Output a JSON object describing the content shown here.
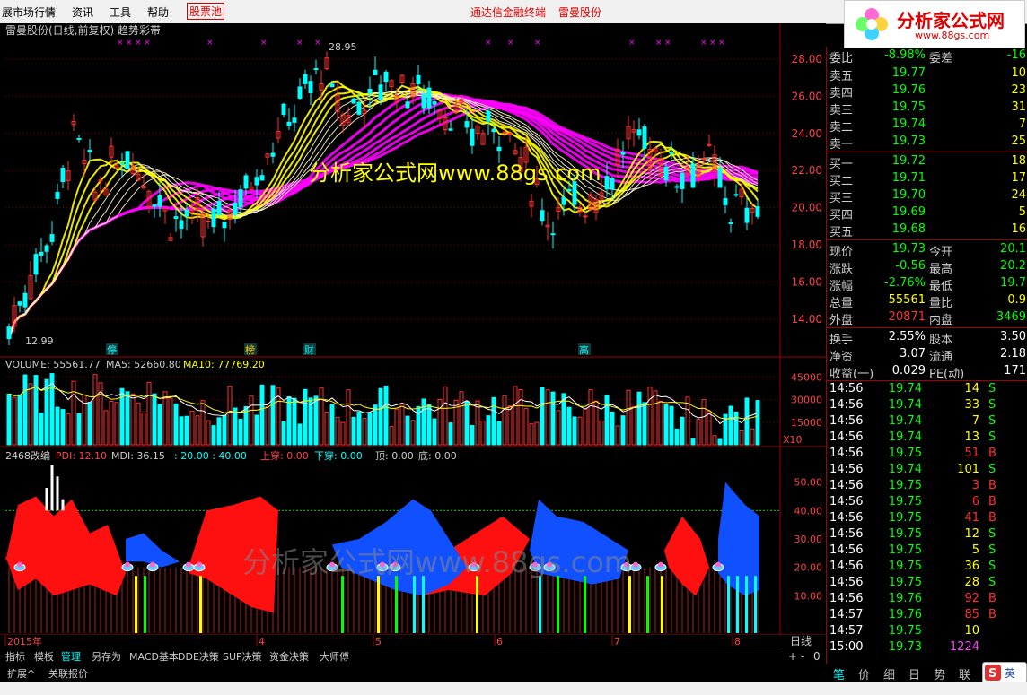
{
  "menu": {
    "items": [
      "展市场行情",
      "资讯",
      "工具",
      "帮助"
    ],
    "highlight": "股票池",
    "center_title": "通达信金融终端",
    "center_stock": "雷曼股份"
  },
  "logo": {
    "title": "分析家公式网",
    "url": "www.88gs.com"
  },
  "chart_title": "雷曼股份(日线,前复权) 趋势彩带",
  "price_chart": {
    "y_ticks": [
      "28.00",
      "26.00",
      "24.00",
      "22.00",
      "20.00",
      "18.00",
      "16.00",
      "14.00"
    ],
    "high_label": "28.95",
    "low_label": "12.99",
    "event_tags": [
      "停",
      "榜",
      "财",
      "高"
    ],
    "watermark": "分析家公式网www.88gs.com"
  },
  "volume_header": {
    "label": "VOLUME: 55561.77",
    "ma5": "MA5: 52660.80",
    "ma10": "MA10: 77769.20"
  },
  "volume_ticks": [
    "45000",
    "30000",
    "15000"
  ],
  "volume_unit": "X10",
  "indicator_header": {
    "name": "2468改编",
    "pdi": "PDI: 12.10",
    "mdi": "MDI: 36.15",
    "vals": ": 20.00 : 40.00",
    "shang": "上穿: 0.00",
    "xia": "下穿: 0.00",
    "ding": "顶: 0.00",
    "di": "底: 0.00"
  },
  "indicator_ticks": [
    "50.00",
    "40.00",
    "30.00",
    "20.00",
    "10.00"
  ],
  "indicator_watermark": "分析家公式网www.88gs.com",
  "x_labels": [
    "2015年",
    "4",
    "5",
    "6",
    "7",
    "8"
  ],
  "period": "日线",
  "tabs": [
    "指标",
    "模板",
    "管理",
    "另存为",
    "MACD基本",
    "DDE决策",
    "SUP决策",
    "资金决策",
    "大师傅"
  ],
  "tabs2": [
    "扩展^",
    "关联报价"
  ],
  "quote": {
    "weibi_label": "委比",
    "weibi": "-8.98%",
    "weicha_label": "委差",
    "weicha": "-16",
    "sells": [
      {
        "label": "卖五",
        "price": "19.77",
        "vol": "10"
      },
      {
        "label": "卖四",
        "price": "19.76",
        "vol": "23"
      },
      {
        "label": "卖三",
        "price": "19.75",
        "vol": "31"
      },
      {
        "label": "卖二",
        "price": "19.74",
        "vol": "7"
      },
      {
        "label": "卖一",
        "price": "19.73",
        "vol": "25"
      }
    ],
    "buys": [
      {
        "label": "买一",
        "price": "19.72",
        "vol": "18"
      },
      {
        "label": "买二",
        "price": "19.71",
        "vol": "17"
      },
      {
        "label": "买三",
        "price": "19.70",
        "vol": "24"
      },
      {
        "label": "买四",
        "price": "19.69",
        "vol": "5"
      },
      {
        "label": "买五",
        "price": "19.68",
        "vol": "16"
      }
    ],
    "stats": [
      {
        "l1": "现价",
        "v1": "19.73",
        "c1": "#00ff00",
        "l2": "今开",
        "v2": "20.1",
        "c2": "#00ff00"
      },
      {
        "l1": "涨跌",
        "v1": "-0.56",
        "c1": "#00ff00",
        "l2": "最高",
        "v2": "20.2",
        "c2": "#00ff00"
      },
      {
        "l1": "涨幅",
        "v1": "-2.76%",
        "c1": "#00ff00",
        "l2": "最低",
        "v2": "19.7",
        "c2": "#00ff00"
      },
      {
        "l1": "总量",
        "v1": "55561",
        "c1": "#ffff00",
        "l2": "量比",
        "v2": "0.9",
        "c2": "#ffff00"
      },
      {
        "l1": "外盘",
        "v1": "20871",
        "c1": "#ff3030",
        "l2": "内盘",
        "v2": "3469",
        "c2": "#00ff00"
      }
    ],
    "stats2": [
      {
        "l1": "换手",
        "v1": "2.55%",
        "l2": "股本",
        "v2": "3.50"
      },
      {
        "l1": "净资",
        "v1": "3.07",
        "l2": "流通",
        "v2": "2.18"
      },
      {
        "l1": "收益(一)",
        "v1": "0.029",
        "l2": "PE(动)",
        "v2": "171"
      }
    ],
    "ticks": [
      {
        "t": "14:56",
        "p": "19.74",
        "v": "14",
        "d": "S"
      },
      {
        "t": "14:56",
        "p": "19.74",
        "v": "33",
        "d": "S"
      },
      {
        "t": "14:56",
        "p": "19.74",
        "v": "7",
        "d": "S"
      },
      {
        "t": "14:56",
        "p": "19.74",
        "v": "13",
        "d": "S"
      },
      {
        "t": "14:56",
        "p": "19.75",
        "v": "51",
        "d": "B"
      },
      {
        "t": "14:56",
        "p": "19.74",
        "v": "101",
        "d": "S"
      },
      {
        "t": "14:56",
        "p": "19.75",
        "v": "3",
        "d": "B"
      },
      {
        "t": "14:56",
        "p": "19.75",
        "v": "6",
        "d": "B"
      },
      {
        "t": "14:56",
        "p": "19.75",
        "v": "41",
        "d": "B"
      },
      {
        "t": "14:56",
        "p": "19.75",
        "v": "12",
        "d": "S"
      },
      {
        "t": "14:56",
        "p": "19.75",
        "v": "5",
        "d": "S"
      },
      {
        "t": "14:56",
        "p": "19.75",
        "v": "36",
        "d": "S"
      },
      {
        "t": "14:56",
        "p": "19.75",
        "v": "28",
        "d": "S"
      },
      {
        "t": "14:56",
        "p": "19.76",
        "v": "92",
        "d": "B"
      },
      {
        "t": "14:57",
        "p": "19.76",
        "v": "85",
        "d": "B"
      },
      {
        "t": "14:57",
        "p": "19.75",
        "v": "10",
        "d": ""
      },
      {
        "t": "15:00",
        "p": "19.73",
        "v": "1224",
        "d": ""
      }
    ]
  },
  "right_buttons": [
    "笔",
    "价",
    "细",
    "日",
    "势",
    "联"
  ],
  "colors": {
    "up": "#ff3030",
    "down": "#00ffff",
    "yellow": "#ffff00",
    "magenta": "#ff00ff",
    "green": "#00ff00"
  }
}
